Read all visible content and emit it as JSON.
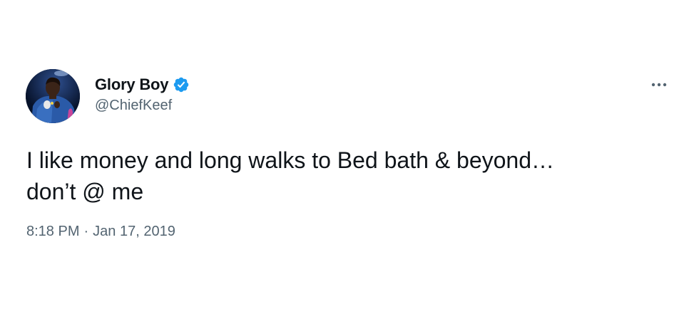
{
  "author": {
    "display_name": "Glory Boy",
    "handle": "@ChiefKeef",
    "verified": true,
    "verified_icon": "verified-badge-icon",
    "avatar_icon": "avatar"
  },
  "tweet": {
    "text": "I like money and long walks to Bed bath & beyond…\ndon’t @ me",
    "time": "8:18 PM",
    "separator": "·",
    "date": "Jan 17, 2019"
  },
  "more_icon": "more-options-icon",
  "colors": {
    "text_primary": "#0f1419",
    "text_secondary": "#536471",
    "verified_blue": "#1d9bf0",
    "background": "#ffffff"
  }
}
